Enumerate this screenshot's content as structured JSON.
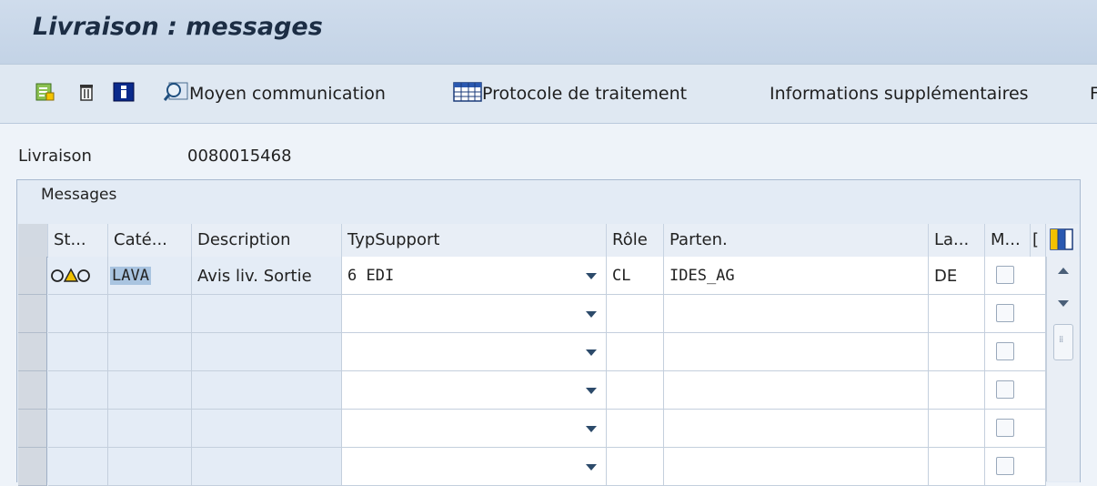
{
  "title": "Livraison : messages",
  "toolbar": {
    "items": [
      {
        "name": "new-entry-icon",
        "label": ""
      },
      {
        "name": "delete-icon",
        "label": ""
      },
      {
        "name": "info-icon",
        "label": ""
      },
      {
        "name": "moyen-communication-icon",
        "label": "Moyen communication"
      },
      {
        "name": "protocole-icon",
        "label": "Protocole de traitement"
      },
      {
        "name": "informations-supplementaires",
        "label": "Informations supplémentaires"
      },
      {
        "name": "more",
        "label": "F"
      }
    ]
  },
  "header": {
    "livraison_label": "Livraison",
    "livraison_value": "0080015468"
  },
  "messages": {
    "title": "Messages",
    "columns": [
      "St...",
      "Caté...",
      "Description",
      "TypSupport",
      "Rôle",
      "Parten.",
      "La...",
      "M...",
      "["
    ],
    "rows": [
      {
        "status_icon": "status-traffic-light",
        "categorie": "LAVA",
        "description": "Avis liv. Sortie",
        "typsupport": "6 EDI",
        "role": "CL",
        "partenaire": "IDES_AG",
        "langue": "DE",
        "m": false
      },
      {
        "status_icon": "",
        "categorie": "",
        "description": "",
        "typsupport": "",
        "role": "",
        "partenaire": "",
        "langue": "",
        "m": false
      },
      {
        "status_icon": "",
        "categorie": "",
        "description": "",
        "typsupport": "",
        "role": "",
        "partenaire": "",
        "langue": "",
        "m": false
      },
      {
        "status_icon": "",
        "categorie": "",
        "description": "",
        "typsupport": "",
        "role": "",
        "partenaire": "",
        "langue": "",
        "m": false
      },
      {
        "status_icon": "",
        "categorie": "",
        "description": "",
        "typsupport": "",
        "role": "",
        "partenaire": "",
        "langue": "",
        "m": false
      },
      {
        "status_icon": "",
        "categorie": "",
        "description": "",
        "typsupport": "",
        "role": "",
        "partenaire": "",
        "langue": "",
        "m": false
      }
    ]
  },
  "colors": {
    "title_bar": "#c9d8ea",
    "toolbar": "#dfe8f2",
    "grid_key": "#e4ecf6",
    "selection_highlight": "#a9c4e0"
  }
}
